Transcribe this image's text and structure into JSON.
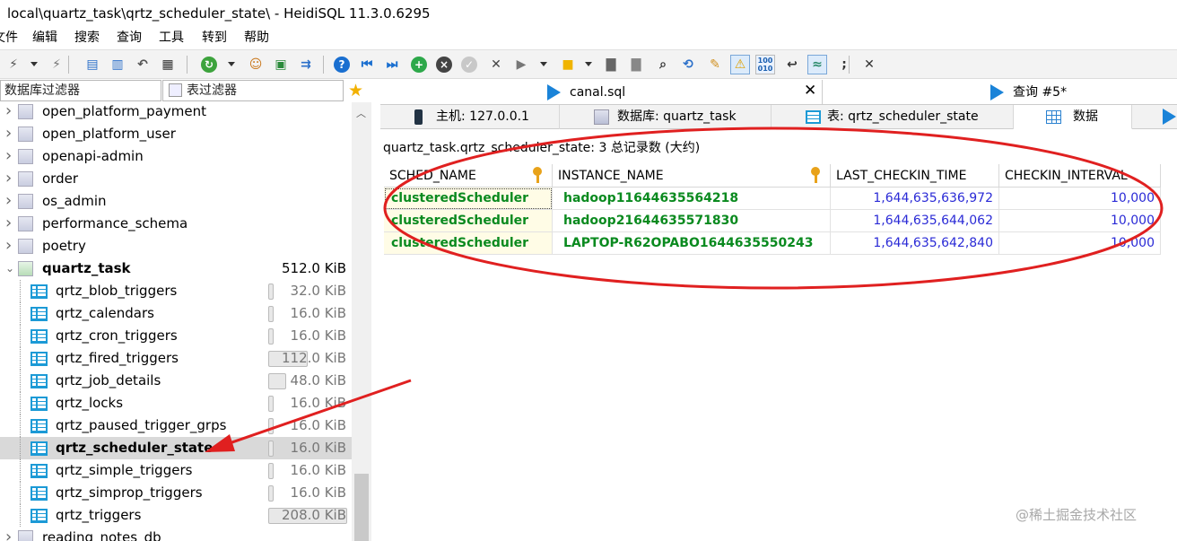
{
  "window": {
    "title": "local\\quartz_task\\qrtz_scheduler_state\\ - HeidiSQL 11.3.0.6295"
  },
  "menu": [
    "文件",
    "编辑",
    "搜索",
    "查询",
    "工具",
    "转到",
    "帮助"
  ],
  "toolbar": {
    "icons": [
      "plug-icon",
      "plug-dropdown",
      "disconnect-icon",
      "copy-icon",
      "paste-icon",
      "undo-icon",
      "print-icon",
      "refresh-icon",
      "refresh-dropdown",
      "users-icon",
      "export-csv-icon",
      "sync-icon",
      "help-icon",
      "first-icon",
      "last-icon",
      "add-icon",
      "delete-icon",
      "check-icon",
      "cancel-icon",
      "run-icon",
      "run-dropdown",
      "folder-icon",
      "folder-dropdown",
      "save-icon",
      "save-db-icon",
      "find-icon",
      "replace-icon",
      "clean-icon",
      "warning-icon",
      "binary-icon",
      "wrap-icon",
      "format-icon",
      "semicolon-icon",
      "close-icon"
    ],
    "binary_label": "100\n010"
  },
  "filters": {
    "db_filter": "数据库过滤器",
    "table_filter": "表过滤器"
  },
  "tree": {
    "databases_before": [
      "open_platform_payment",
      "open_platform_user",
      "openapi-admin",
      "order",
      "os_admin",
      "performance_schema",
      "poetry"
    ],
    "active_db": {
      "name": "quartz_task",
      "size": "512.0 KiB"
    },
    "tables": [
      {
        "name": "qrtz_blob_triggers",
        "size": "32.0 KiB",
        "fill": 0.07
      },
      {
        "name": "qrtz_calendars",
        "size": "16.0 KiB",
        "fill": 0.03
      },
      {
        "name": "qrtz_cron_triggers",
        "size": "16.0 KiB",
        "fill": 0.03
      },
      {
        "name": "qrtz_fired_triggers",
        "size": "112.0 KiB",
        "fill": 0.5
      },
      {
        "name": "qrtz_job_details",
        "size": "48.0 KiB",
        "fill": 0.23
      },
      {
        "name": "qrtz_locks",
        "size": "16.0 KiB",
        "fill": 0.03
      },
      {
        "name": "qrtz_paused_trigger_grps",
        "size": "16.0 KiB",
        "fill": 0.03
      },
      {
        "name": "qrtz_scheduler_state",
        "size": "16.0 KiB",
        "fill": 0.03,
        "selected": true
      },
      {
        "name": "qrtz_simple_triggers",
        "size": "16.0 KiB",
        "fill": 0.03
      },
      {
        "name": "qrtz_simprop_triggers",
        "size": "16.0 KiB",
        "fill": 0.03
      },
      {
        "name": "qrtz_triggers",
        "size": "208.0 KiB",
        "fill": 1.0
      }
    ],
    "databases_after": [
      "reading_notes_db"
    ]
  },
  "query_tabs": [
    {
      "label": "canal.sql",
      "closable": true
    },
    {
      "label": "查询 #5*",
      "closable": false
    }
  ],
  "tabs": [
    {
      "label": "主机: 127.0.0.1",
      "icon": "server-icon"
    },
    {
      "label": "数据库: quartz_task",
      "icon": "database-icon"
    },
    {
      "label": "表: qrtz_scheduler_state",
      "icon": "table-icon"
    },
    {
      "label": "数据",
      "icon": "grid-icon",
      "active": true
    }
  ],
  "data_info": "quartz_task.qrtz_scheduler_state: 3 总记录数 (大约)",
  "grid": {
    "columns": [
      {
        "label": "SCHED_NAME",
        "key": true
      },
      {
        "label": "INSTANCE_NAME",
        "key": true
      },
      {
        "label": "LAST_CHECKIN_TIME",
        "key": false
      },
      {
        "label": "CHECKIN_INTERVAL",
        "key": false
      }
    ],
    "rows": [
      [
        "clusteredScheduler",
        "hadoop11644635564218",
        "1,644,635,636,972",
        "10,000"
      ],
      [
        "clusteredScheduler",
        "hadoop21644635571830",
        "1,644,635,644,062",
        "10,000"
      ],
      [
        "clusteredScheduler",
        "LAPTOP-R62OPABO1644635550243",
        "1,644,635,642,840",
        "10,000"
      ]
    ]
  },
  "annotation": {
    "ellipse_color": "#e02020",
    "arrow_color": "#e02020"
  },
  "watermark": "@稀土掘金技术社区"
}
